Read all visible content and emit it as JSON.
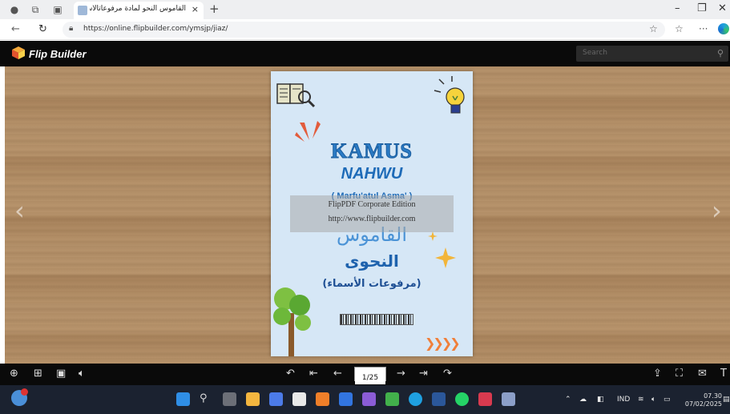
{
  "browser": {
    "tab_title": "القاموس النحو لمادة مرفوعاتالأسماء",
    "url": "https://online.flipbuilder.com/ymsjp/jiaz/",
    "new_tab_symbol": "+",
    "close_tab_symbol": "×"
  },
  "flipbuilder": {
    "brand": "Flip Builder",
    "search_placeholder": "Search"
  },
  "book_cover": {
    "title_latin": "KAMUS",
    "subtitle_latin": "NAHWU",
    "edition_note": "( Marfu'atul Asma' )",
    "title_arabic": "القاموس",
    "subtitle_arabic": "النحوى",
    "note_arabic": "(مرفوعات الأسماء)"
  },
  "watermark": {
    "line1": "FlipPDF Corporate Edition",
    "line2": "http://www.flipbuilder.com"
  },
  "toolbar": {
    "page_indicator": "1/25"
  },
  "taskbar": {
    "language": "IND",
    "time": "07.30",
    "date": "07/02/2025"
  },
  "colors": {
    "accent_blue": "#2b7bc5",
    "page_bg": "#d6e7f6",
    "chevron_orange": "#f07f3a",
    "header_black": "#0a0a0a"
  }
}
